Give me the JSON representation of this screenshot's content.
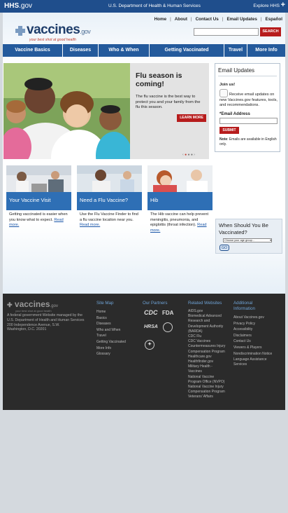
{
  "hhs": {
    "logo": "HHS",
    "logo_gov": ".gov",
    "dept": "U.S. Department of Health & Human Services",
    "explore": "Explore HHS"
  },
  "toplinks": [
    "Home",
    "About",
    "Contact Us",
    "Email Updates",
    "Español"
  ],
  "logo": {
    "word": "vaccines",
    "gov": ".gov",
    "tagline": "your best shot at good health"
  },
  "search": {
    "placeholder": "",
    "button": "SEARCH"
  },
  "nav": [
    {
      "label": "Vaccine Basics"
    },
    {
      "label": "Diseases"
    },
    {
      "label": "Who & When"
    },
    {
      "label": "Getting Vaccinated"
    },
    {
      "label": "Travel"
    },
    {
      "label": "More Info"
    }
  ],
  "hero": {
    "title": "Flu season is coming!",
    "text": "The flu vaccine is the best way to protect you and your family from the flu this season.",
    "button": "LEARN MORE"
  },
  "email": {
    "heading": "Email Updates",
    "join": "Join us!",
    "receive": "Receive email updates on new Vaccines.gov features, tools, and recommendations.",
    "address_label": "*Email Address",
    "submit": "SUBMIT",
    "note_bold": "Note",
    "note": ": Emails are available in English only."
  },
  "cards": [
    {
      "label": "Your Vaccine Visit",
      "text": "Getting vaccinated is easier when you know what to expect.",
      "more": "Read more."
    },
    {
      "label": "Need a Flu Vaccine?",
      "text": "Use the Flu Vaccine Finder to find a flu vaccine location near you.",
      "more": "Read more."
    },
    {
      "label": "Hib",
      "text": "The Hib vaccine can help prevent meningitis, pneumonia, and epiglottis (throat infection).",
      "more": "Read more."
    }
  ],
  "when": {
    "title": "When Should You Be Vaccinated?",
    "select": "Choose your age group...",
    "go": "GO"
  },
  "footer": {
    "logo": "vaccines",
    "logo_gov": ".gov",
    "tagline": "your best shot at good health",
    "about": "A federal government Website managed by the U.S. Department of Health and Human Services",
    "address1": "200 Independence Avenue, S.W.",
    "address2": "Washington, D.C. 20201",
    "sitemap": {
      "heading": "Site Map",
      "items": [
        "Home",
        "Basics",
        "Diseases",
        "Who and When",
        "Travel",
        "Getting Vaccinated",
        "More Info",
        "Glossary"
      ]
    },
    "partners": {
      "heading": "Our Partners",
      "cdc": "CDC",
      "fda": "FDA",
      "hrsa": "HRSA"
    },
    "related": {
      "heading": "Related Websites",
      "items": [
        "AIDS.gov",
        "Biomedical Advanced",
        "Research and",
        "Development Authority",
        "(BARDA)",
        "CDC Flu",
        "CDC Vaccines",
        "Countermeasures Injury",
        "Compensation Program",
        "Healthcare.gov",
        "Healthfinder.gov",
        "Military Health -",
        "Vaccines",
        "National Vaccine",
        "Program Office (NVPO)",
        "National Vaccine Injury",
        "Compensation Program",
        "Veterans' Affairs"
      ]
    },
    "additional": {
      "heading1": "Additional",
      "heading2": "Information",
      "items": [
        "About Vaccines.gov",
        "Privacy Policy",
        "Accessibility",
        "Disclaimers",
        "Contact Us",
        "Viewers & Players",
        "Nondiscrimination Notice",
        "Language Assistance",
        "Services"
      ]
    }
  }
}
